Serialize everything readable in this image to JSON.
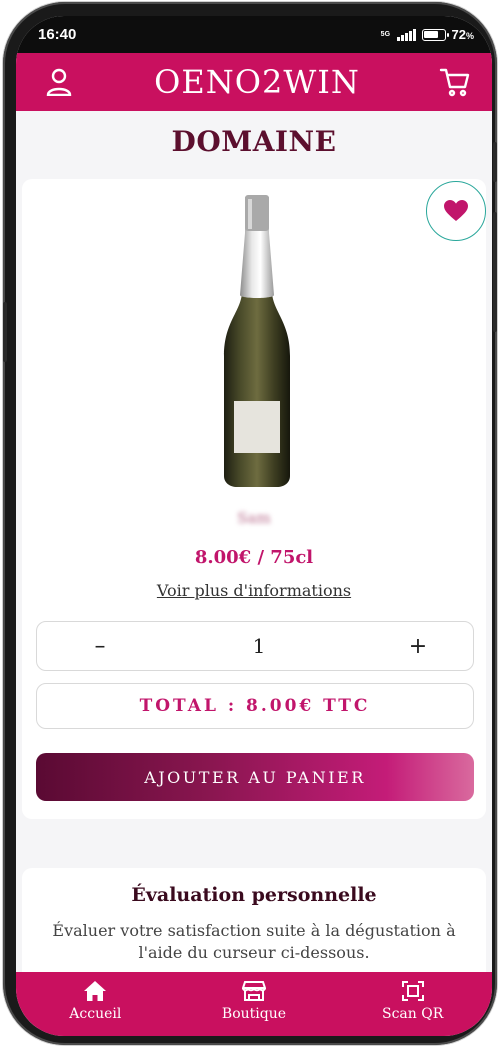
{
  "status_bar": {
    "time": "16:40",
    "network_top": "5G",
    "network_bottom": "ᵛ",
    "battery_pct": "72",
    "battery_unit": "%"
  },
  "header": {
    "title": "OENO2WIN",
    "left_icon": "user-icon",
    "right_icon": "cart-icon"
  },
  "page": {
    "title": "DOMAINE"
  },
  "product": {
    "name": "Sam",
    "price": "8.00€ / 75cl",
    "more_info": "Voir plus d'informations",
    "favorite_icon": "heart-icon"
  },
  "quantity": {
    "minus": "–",
    "value": "1",
    "plus": "+"
  },
  "total": {
    "label": "TOTAL : 8.00€ TTC"
  },
  "cart_button": {
    "label": "AJOUTER AU PANIER"
  },
  "evaluation": {
    "title": "Évaluation personnelle",
    "description": "Évaluer votre satisfaction suite à la dégustation à l'aide du curseur ci-dessous."
  },
  "bottom_nav": {
    "items": [
      {
        "label": "Accueil",
        "icon": "home-icon"
      },
      {
        "label": "Boutique",
        "icon": "store-icon"
      },
      {
        "label": "Scan QR",
        "icon": "scan-icon"
      }
    ]
  },
  "colors": {
    "primary": "#c9105f",
    "dark_title": "#5c0f2e",
    "accent_teal": "#2aa79b"
  }
}
